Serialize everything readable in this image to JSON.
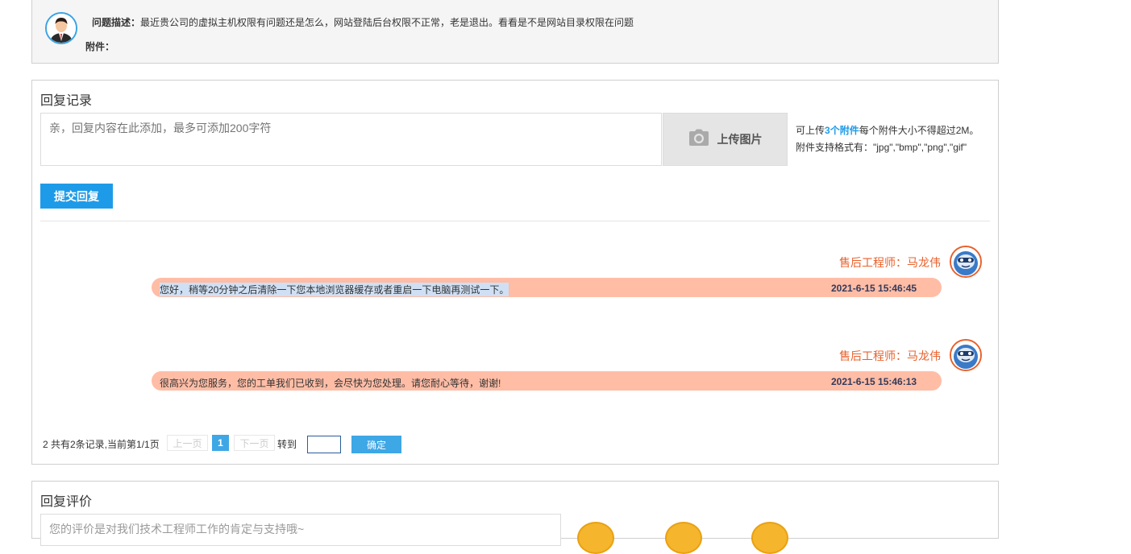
{
  "question": {
    "desc_label": "问题描述：",
    "desc_text": "最近贵公司的虚拟主机权限有问题还是怎么，网站登陆后台权限不正常，老是退出。看看是不是网站目录权限在问题",
    "attach_label": "附件："
  },
  "reply": {
    "title": "回复记录",
    "textarea_placeholder": "亲，回复内容在此添加，最多可添加200字符",
    "upload_label": "上传图片",
    "note_line1_prefix": "可上传",
    "note_line1_highlight": "3个附件",
    "note_line1_suffix": "每个附件大小不得超过2M。",
    "note_line2": "附件支持格式有：\"jpg\",\"bmp\",\"png\",\"gif\"",
    "submit_label": "提交回复"
  },
  "messages": [
    {
      "engineer": "售后工程师：马龙伟",
      "text": "您好，稍等20分钟之后清除一下您本地浏览器缓存或者重启一下电脑再测试一下。",
      "time": "2021-6-15 15:46:45"
    },
    {
      "engineer": "售后工程师：马龙伟",
      "text": "很高兴为您服务，您的工单我们已收到，会尽快为您处理。请您耐心等待，谢谢!",
      "time": "2021-6-15 15:46:13"
    }
  ],
  "pagination": {
    "summary": "2 共有2条记录,当前第1/1页",
    "prev": "上一页",
    "current": "1",
    "next": "下一页",
    "goto": "转到",
    "confirm": "确定"
  },
  "rating": {
    "title": "回复评价",
    "textarea_text": "您的评价是对我们技术工程师工作的肯定与支持哦~"
  },
  "colors": {
    "accent": "#1e9be8",
    "engineer_name": "#e8612c",
    "bubble": "#ffbda6"
  }
}
